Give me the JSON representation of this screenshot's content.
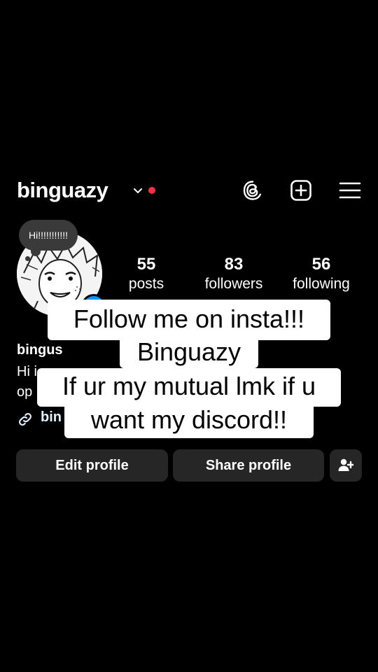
{
  "header": {
    "username": "binguazy",
    "icons": [
      "chevron-down-icon",
      "threads-icon",
      "create-icon",
      "menu-icon"
    ],
    "notification_dot_color": "#ff3040"
  },
  "note": {
    "text": "Hi!!!!!!!!!!!"
  },
  "stats": [
    {
      "value": "55",
      "label": "posts"
    },
    {
      "value": "83",
      "label": "followers"
    },
    {
      "value": "56",
      "label": "following"
    }
  ],
  "bio": {
    "display_name": "bingus",
    "line1": "Hi i",
    "line2": "op",
    "link": "bin"
  },
  "captions": {
    "line1": "Follow me on insta!!!",
    "line2": "Binguazy",
    "line3": "If ur my mutual lmk if u",
    "line4": "want my discord!!"
  },
  "buttons": {
    "edit_profile": "Edit profile",
    "share_profile": "Share profile",
    "add_user_icon": "add-user-icon"
  },
  "colors": {
    "background": "#000000",
    "button": "#262626",
    "accent": "#0095f6"
  }
}
